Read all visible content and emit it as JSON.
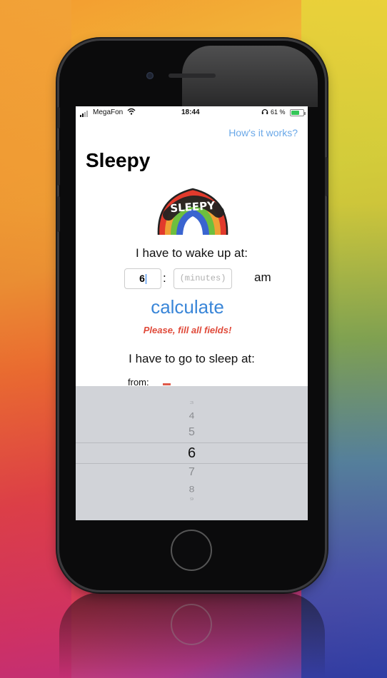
{
  "status_bar": {
    "carrier": "MegaFon",
    "time": "18:44",
    "battery_percent": "61 %",
    "icons": [
      "signal-icon",
      "wifi-icon",
      "headphones-icon",
      "battery-icon"
    ]
  },
  "header": {
    "help_link": "How's it works?",
    "title": "Sleepy"
  },
  "logo": {
    "text": "SLEEPY",
    "icon": "rainbow-logo"
  },
  "wake": {
    "label": "I have to wake up at:",
    "hour_value": "6",
    "separator": ":",
    "minutes_placeholder": "(minutes)",
    "period": "am"
  },
  "actions": {
    "calculate_label": "calculate",
    "warning": "Please, fill all fields!"
  },
  "sleep": {
    "label": "I have to go to sleep at:",
    "from_label": "from:"
  },
  "picker": {
    "items": [
      "3",
      "4",
      "5",
      "6",
      "7",
      "8",
      "9"
    ],
    "selected": "6"
  },
  "colors": {
    "accent": "#3a86d8",
    "link": "#6aa8e8",
    "warning": "#e04a3a",
    "picker_bg": "#d1d3d8"
  }
}
